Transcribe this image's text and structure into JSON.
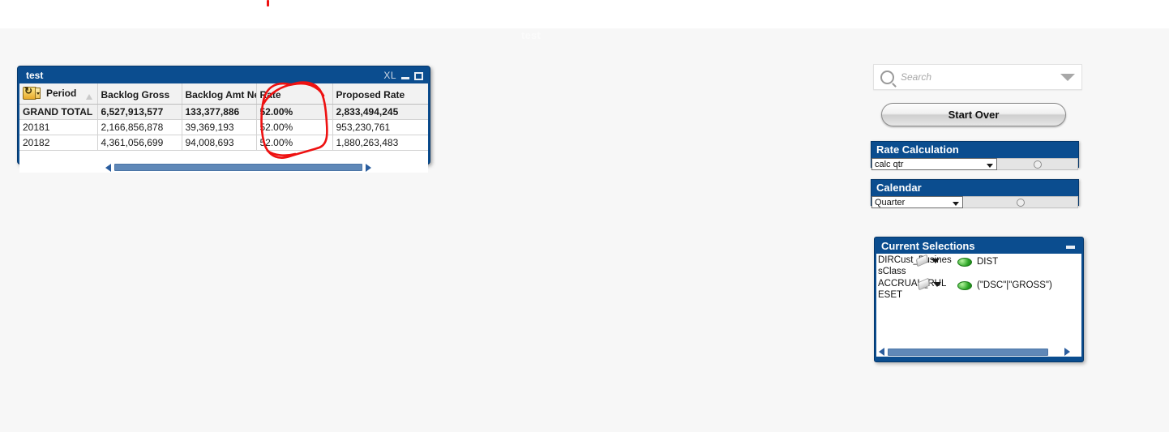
{
  "page": {
    "watermark_title": "test"
  },
  "chart_object": {
    "title": "test",
    "titlebar_icons": {
      "export_label": "XL",
      "minimize": "minimize-icon",
      "maximize": "maximize-icon"
    },
    "refresh_icon": "refresh-icon",
    "columns": [
      "Period",
      "Backlog Gross",
      "Backlog Amt Net",
      "Rate",
      "Proposed Rate"
    ],
    "rows": [
      {
        "period": "GRAND TOTAL",
        "backlog_gross": "6,527,913,577",
        "backlog_amt_net": "133,377,886",
        "rate": "52.00%",
        "proposed_rate": "2,833,494,245",
        "is_total": true
      },
      {
        "period": "20181",
        "backlog_gross": "2,166,856,878",
        "backlog_amt_net": "39,369,193",
        "rate": "52.00%",
        "proposed_rate": "953,230,761",
        "is_total": false
      },
      {
        "period": "20182",
        "backlog_gross": "4,361,056,699",
        "backlog_amt_net": "94,008,693",
        "rate": "52.00%",
        "proposed_rate": "1,880,263,483",
        "is_total": false
      }
    ]
  },
  "annotation": {
    "color": "#ee1111",
    "shape": "hand-drawn-ellipse-around-rate-column"
  },
  "search": {
    "placeholder": "Search",
    "icon": "search-icon",
    "dropdown_icon": "chevron-down-icon"
  },
  "start_over": {
    "label": "Start Over"
  },
  "rate_calculation": {
    "title": "Rate Calculation",
    "selected": "calc qtr"
  },
  "calendar": {
    "title": "Calendar",
    "selected": "Quarter"
  },
  "current_selections": {
    "title": "Current Selections",
    "minimize_icon": "minimize-icon",
    "entries": [
      {
        "field": "DIRCust_BusinessClass",
        "value": "DIST"
      },
      {
        "field": "ACCRUAL_RULESET",
        "value": "(\"DSC\"|\"GROSS\")"
      }
    ]
  }
}
